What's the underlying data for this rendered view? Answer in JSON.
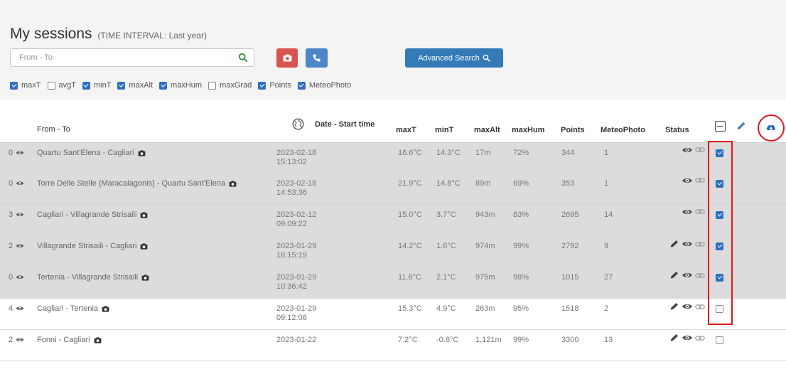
{
  "page": {
    "title": "My sessions",
    "subtitle": "(TIME INTERVAL: Last year)"
  },
  "search": {
    "placeholder": "From - To",
    "advanced_label": "Advanced Search"
  },
  "filters": [
    {
      "label": "maxT",
      "checked": true
    },
    {
      "label": "avgT",
      "checked": false
    },
    {
      "label": "minT",
      "checked": true
    },
    {
      "label": "maxAlt",
      "checked": true
    },
    {
      "label": "maxHum",
      "checked": true
    },
    {
      "label": "maxGrad",
      "checked": false
    },
    {
      "label": "Points",
      "checked": true
    },
    {
      "label": "MeteoPhoto",
      "checked": true
    }
  ],
  "columns": {
    "from_to": "From - To",
    "date": "Date - Start time",
    "maxT": "maxT",
    "minT": "minT",
    "maxAlt": "maxAlt",
    "maxHum": "maxHum",
    "points": "Points",
    "meteophoto": "MeteoPhoto",
    "status": "Status"
  },
  "rows": [
    {
      "count": "0",
      "route": "Quartu Sant'Elena - Cagliari",
      "date": "2023-02-18",
      "time": "15:13:02",
      "maxT": "16.6°C",
      "minT": "14.3°C",
      "maxAlt": "17m",
      "maxHum": "72%",
      "points": "344",
      "meteophoto": "1",
      "edit": false,
      "selected": true
    },
    {
      "count": "0",
      "route": "Torre Delle Stelle (Maracalagonis) - Quartu Sant'Elena",
      "date": "2023-02-18",
      "time": "14:53:36",
      "maxT": "21.9°C",
      "minT": "14.8°C",
      "maxAlt": "89m",
      "maxHum": "69%",
      "points": "353",
      "meteophoto": "1",
      "edit": false,
      "selected": true
    },
    {
      "count": "3",
      "route": "Cagliari - Villagrande Strisaili",
      "date": "2023-02-12",
      "time": "09:09:22",
      "maxT": "15.0°C",
      "minT": "3.7°C",
      "maxAlt": "943m",
      "maxHum": "83%",
      "points": "2695",
      "meteophoto": "14",
      "edit": false,
      "selected": true
    },
    {
      "count": "2",
      "route": "Villagrande Strisaili - Cagliari",
      "date": "2023-01-29",
      "time": "16:15:19",
      "maxT": "14.2°C",
      "minT": "1.6°C",
      "maxAlt": "974m",
      "maxHum": "99%",
      "points": "2792",
      "meteophoto": "9",
      "edit": true,
      "selected": true
    },
    {
      "count": "0",
      "route": "Tertenia - Villagrande Strisaili",
      "date": "2023-01-29",
      "time": "10:36:42",
      "maxT": "11.6°C",
      "minT": "2.1°C",
      "maxAlt": "975m",
      "maxHum": "98%",
      "points": "1015",
      "meteophoto": "27",
      "edit": true,
      "selected": true
    },
    {
      "count": "4",
      "route": "Cagliari - Tertenia",
      "date": "2023-01-29",
      "time": "09:12:08",
      "maxT": "15.3°C",
      "minT": "4.9°C",
      "maxAlt": "263m",
      "maxHum": "95%",
      "points": "1518",
      "meteophoto": "2",
      "edit": true,
      "selected": false
    },
    {
      "count": "2",
      "route": "Fonni - Cagliari",
      "date": "2023-01-22",
      "time": "",
      "maxT": "7.2°C",
      "minT": "-0.8°C",
      "maxAlt": "1,121m",
      "maxHum": "99%",
      "points": "3300",
      "meteophoto": "13",
      "edit": true,
      "selected": false
    }
  ],
  "colors": {
    "primary": "#337ab7",
    "danger": "#d9534f",
    "checkbox": "#2f6fbf",
    "highlight": "#e01818",
    "selected_row": "#dcdcdc"
  }
}
